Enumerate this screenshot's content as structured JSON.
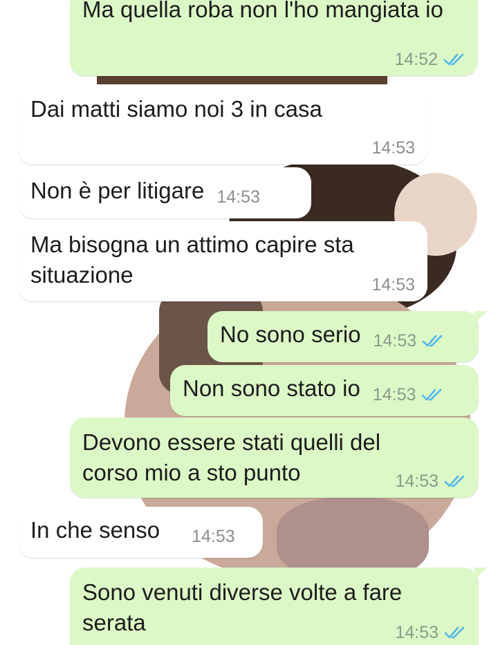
{
  "colors": {
    "outgoing_bubble": "#dcf8c6",
    "incoming_bubble": "#ffffff",
    "read_tick": "#4fb6ec"
  },
  "messages": [
    {
      "direction": "out",
      "text": "Ma quella roba non l'ho mangiata io",
      "time": "14:52",
      "status_icon": "double-check-read-icon"
    },
    {
      "direction": "in",
      "text": "Dai matti siamo noi 3 in casa",
      "time": "14:53"
    },
    {
      "direction": "in",
      "text": "Non è per litigare",
      "time": "14:53"
    },
    {
      "direction": "in",
      "text": "Ma bisogna un attimo capire sta situazione",
      "time": "14:53"
    },
    {
      "direction": "out",
      "text": "No sono serio",
      "time": "14:53",
      "status_icon": "double-check-read-icon"
    },
    {
      "direction": "out",
      "text": "Non sono stato io",
      "time": "14:53",
      "status_icon": "double-check-read-icon"
    },
    {
      "direction": "out",
      "text": "Devono essere stati quelli del corso mio a sto punto",
      "time": "14:53",
      "status_icon": "double-check-read-icon"
    },
    {
      "direction": "in",
      "text": "In che senso",
      "time": "14:53"
    },
    {
      "direction": "out",
      "text": "Sono venuti diverse volte a fare serata",
      "time": "14:53",
      "status_icon": "double-check-read-icon"
    }
  ]
}
